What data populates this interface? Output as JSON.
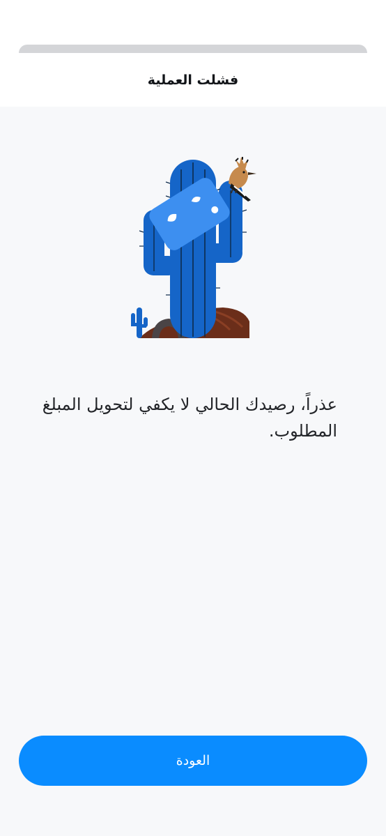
{
  "header": {
    "title": "فشلت العملية"
  },
  "illustration": {
    "icon": "cactus-with-bird-and-card-illustration"
  },
  "message": {
    "text": "عذراً، رصيدك الحالي لا يكفي لتحويل المبلغ المطلوب."
  },
  "actions": {
    "back_label": "العودة"
  },
  "colors": {
    "primary": "#0a8cff",
    "cactus": "#1565c8",
    "card": "#3d8ff0",
    "rock": "#6b2e1a",
    "background": "#f7f8fa"
  }
}
